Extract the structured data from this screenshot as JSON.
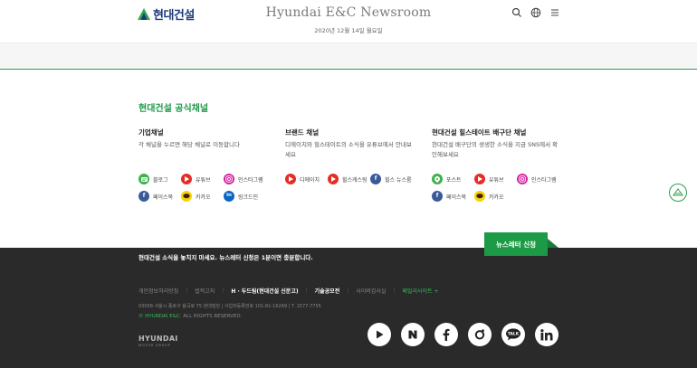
{
  "header": {
    "logo_text": "현대건설",
    "title": "Hyundai E&C Newsroom",
    "date": "2020년 12월 14일 월요일",
    "icons": [
      "search-icon",
      "globe-icon",
      "menu-icon"
    ]
  },
  "channels": {
    "section_title": "현대건설 공식채널",
    "columns": [
      {
        "title": "기업채널",
        "description": "각 채널을 누르면 해당 채널로 이동합니다",
        "items": [
          {
            "label": "블로그",
            "icon": "blog-icon",
            "color": "#3bb34a"
          },
          {
            "label": "유튜브",
            "icon": "youtube-icon",
            "color": "#e52d27"
          },
          {
            "label": "인스타그램",
            "icon": "instagram-icon",
            "color": "#d6249f"
          },
          {
            "label": "페이스북",
            "icon": "facebook-icon",
            "color": "#3b5998"
          },
          {
            "label": "카카오",
            "icon": "kakao-icon",
            "color": "#f7d100"
          },
          {
            "label": "링크드인",
            "icon": "linkedin-icon",
            "color": "#0a66c2"
          }
        ]
      },
      {
        "title": "브랜드 채널",
        "description": "디에이치와 힐스테이트의 소식을 유튜브에서 안내보세요",
        "items": [
          {
            "label": "디에이치",
            "icon": "youtube-icon",
            "color": "#e52d27"
          },
          {
            "label": "힐스캐스팅",
            "icon": "youtube-icon",
            "color": "#e52d27"
          },
          {
            "label": "힐스 뉴스룸",
            "icon": "facebook-icon",
            "color": "#3b5998"
          }
        ]
      },
      {
        "title": "현대건설 힐스테이트 배구단 채널",
        "description": "현대건설 배구단의 생생한 소식을 지금 SNS에서 확인해보세요",
        "items": [
          {
            "label": "포스트",
            "icon": "post-icon",
            "color": "#3bb34a"
          },
          {
            "label": "유튜브",
            "icon": "youtube-icon",
            "color": "#e52d27"
          },
          {
            "label": "인스타그램",
            "icon": "instagram-icon",
            "color": "#d6249f"
          },
          {
            "label": "페이스북",
            "icon": "facebook-icon",
            "color": "#3b5998"
          },
          {
            "label": "카카오",
            "icon": "kakao-icon",
            "color": "#f7d100"
          }
        ]
      }
    ]
  },
  "footer": {
    "subscribe_text": "현대건설 소식을 놓치지 마세요. 뉴스레터 신청은 1분이면 충분합니다.",
    "subscribe_button": "뉴스레터 신청",
    "links": [
      {
        "label": "개인정보처리방침",
        "style": "dim"
      },
      {
        "label": "법적고지",
        "style": "dim"
      },
      {
        "label": "H · 두드림(현대건설 신문고)",
        "style": "strong"
      },
      {
        "label": "기술공모전",
        "style": "strong"
      },
      {
        "label": "사이버감사실",
        "style": "dim"
      },
      {
        "label": "패밀리사이트 +",
        "style": "green"
      }
    ],
    "address": "03058 서울시 종로구 율곡로 75 현대빌딩 | 사업자등록번호 101-81-16269 | T. 1577-7755",
    "copyright_brand": "© HYUNDAI E&C.",
    "copyright_rest": " ALL RIGHTS RESERVED.",
    "group_logo_text": "HYUNDAI",
    "group_logo_sub": "MOTOR GROUP",
    "social": [
      "youtube-icon",
      "naver-post-icon",
      "facebook-icon",
      "instagram-icon",
      "kakao-talk-icon",
      "linkedin-icon"
    ]
  },
  "colors": {
    "accent_green": "#1d9a45",
    "footer_bg": "#2a2a2a"
  }
}
